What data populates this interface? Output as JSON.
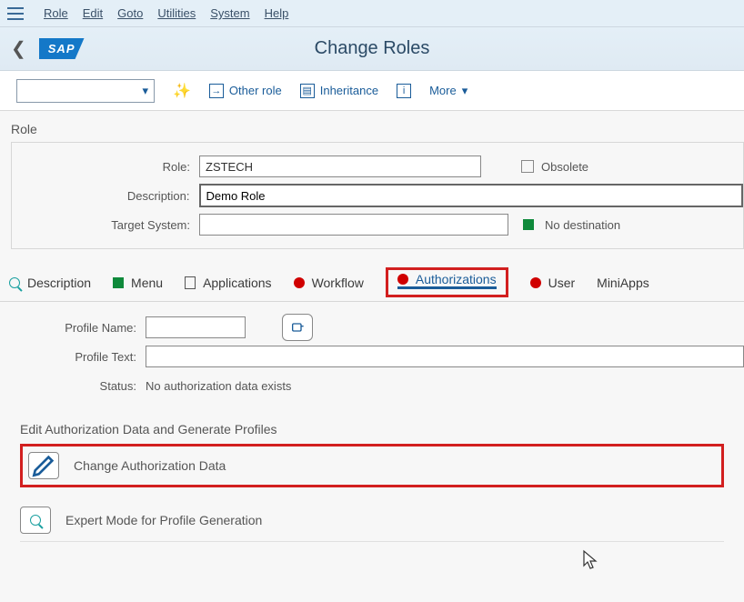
{
  "menubar": {
    "role": "Role",
    "edit": "Edit",
    "goto": "Goto",
    "utilities": "Utilities",
    "system": "System",
    "help": "Help"
  },
  "page_title": "Change Roles",
  "toolbar": {
    "other_role": "Other role",
    "inheritance": "Inheritance",
    "more": "More"
  },
  "role_section": {
    "header": "Role",
    "role_label": "Role:",
    "role_value": "ZSTECH",
    "obsolete_label": "Obsolete",
    "desc_label": "Description:",
    "desc_value": "Demo Role",
    "target_label": "Target System:",
    "target_value": "",
    "no_dest": "No destination"
  },
  "tabs": {
    "description": "Description",
    "menu": "Menu",
    "applications": "Applications",
    "workflow": "Workflow",
    "authorizations": "Authorizations",
    "user": "User",
    "miniapps": "MiniApps"
  },
  "profile": {
    "name_label": "Profile Name:",
    "name_value": "",
    "text_label": "Profile Text:",
    "text_value": "",
    "status_label": "Status:",
    "status_value": "No authorization data exists"
  },
  "edit_auth": {
    "header": "Edit Authorization Data and Generate Profiles",
    "change_auth": "Change Authorization Data",
    "expert_mode": "Expert Mode for Profile Generation"
  }
}
